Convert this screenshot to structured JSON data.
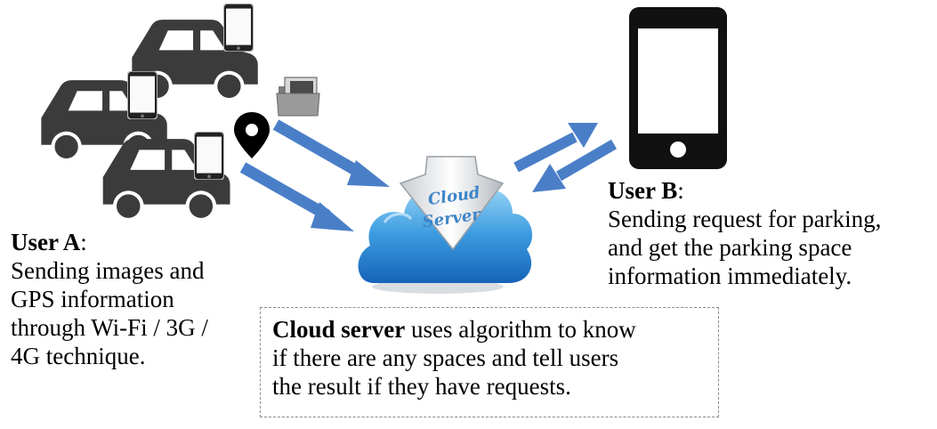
{
  "user_a": {
    "title": "User A",
    "lines": [
      "Sending images and",
      "GPS information",
      "through Wi-Fi / 3G /",
      "4G technique."
    ]
  },
  "user_b": {
    "title": "User B",
    "lines": [
      "Sending request for parking,",
      "and get the parking space",
      "information immediately."
    ]
  },
  "server_box": {
    "bold": "Cloud server",
    "lines": [
      " uses algorithm to know",
      "if there are any spaces and tell users",
      "the result if they have requests."
    ]
  },
  "cloud": {
    "line1": "Cloud",
    "line2": "Server"
  },
  "colors": {
    "arrow": "#4a7fc8",
    "car": "#3b3b3b",
    "phone": "#111111",
    "cloud_light": "#7cc6f2",
    "cloud_dark": "#1c6fc4"
  },
  "icons": [
    "car-icon",
    "smartphone-icon",
    "location-pin-icon",
    "photo-folder-icon",
    "cloud-server-icon",
    "arrow-icon"
  ]
}
